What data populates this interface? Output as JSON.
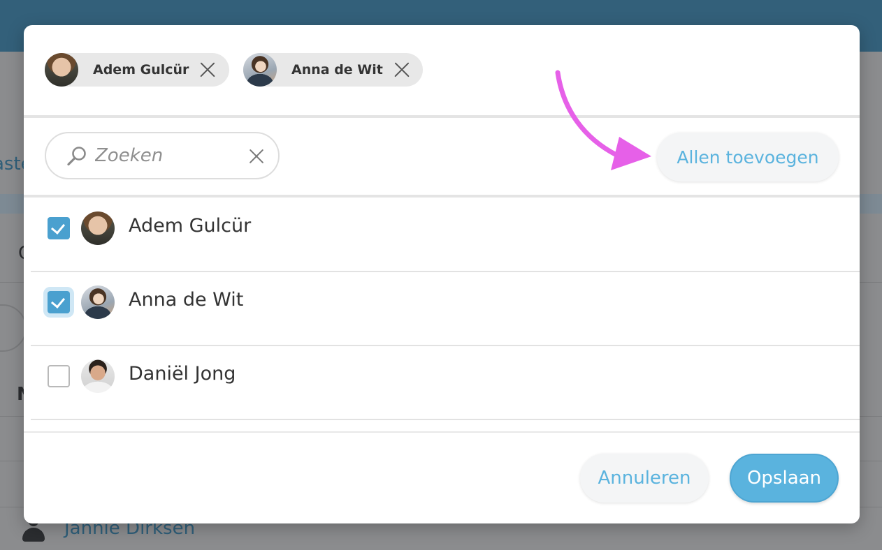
{
  "background": {
    "fragment_left": "aste",
    "row_initial_1": "C",
    "col_initial": "N",
    "row_name": "Jannie Dirksen"
  },
  "dialog": {
    "selected_chips": [
      {
        "name": "Adem Gulcür",
        "avatar": "photo-adem"
      },
      {
        "name": "Anna de Wit",
        "avatar": "photo-anna"
      }
    ],
    "search": {
      "placeholder": "Zoeken",
      "value": ""
    },
    "add_all_label": "Allen toevoegen",
    "annotation": {
      "icon": "curved-arrow-icon",
      "color": "#e660e8"
    },
    "people": [
      {
        "name": "Adem Gulcür",
        "checked": true,
        "avatar": "photo-adem"
      },
      {
        "name": "Anna de Wit",
        "checked": true,
        "avatar": "photo-anna"
      },
      {
        "name": "Daniël Jong",
        "checked": false,
        "avatar": "photo-daniel"
      }
    ],
    "cancel_label": "Annuleren",
    "save_label": "Opslaan"
  },
  "colors": {
    "accent": "#5ab3de",
    "checkbox": "#4aa0cf",
    "header": "#33607a"
  }
}
